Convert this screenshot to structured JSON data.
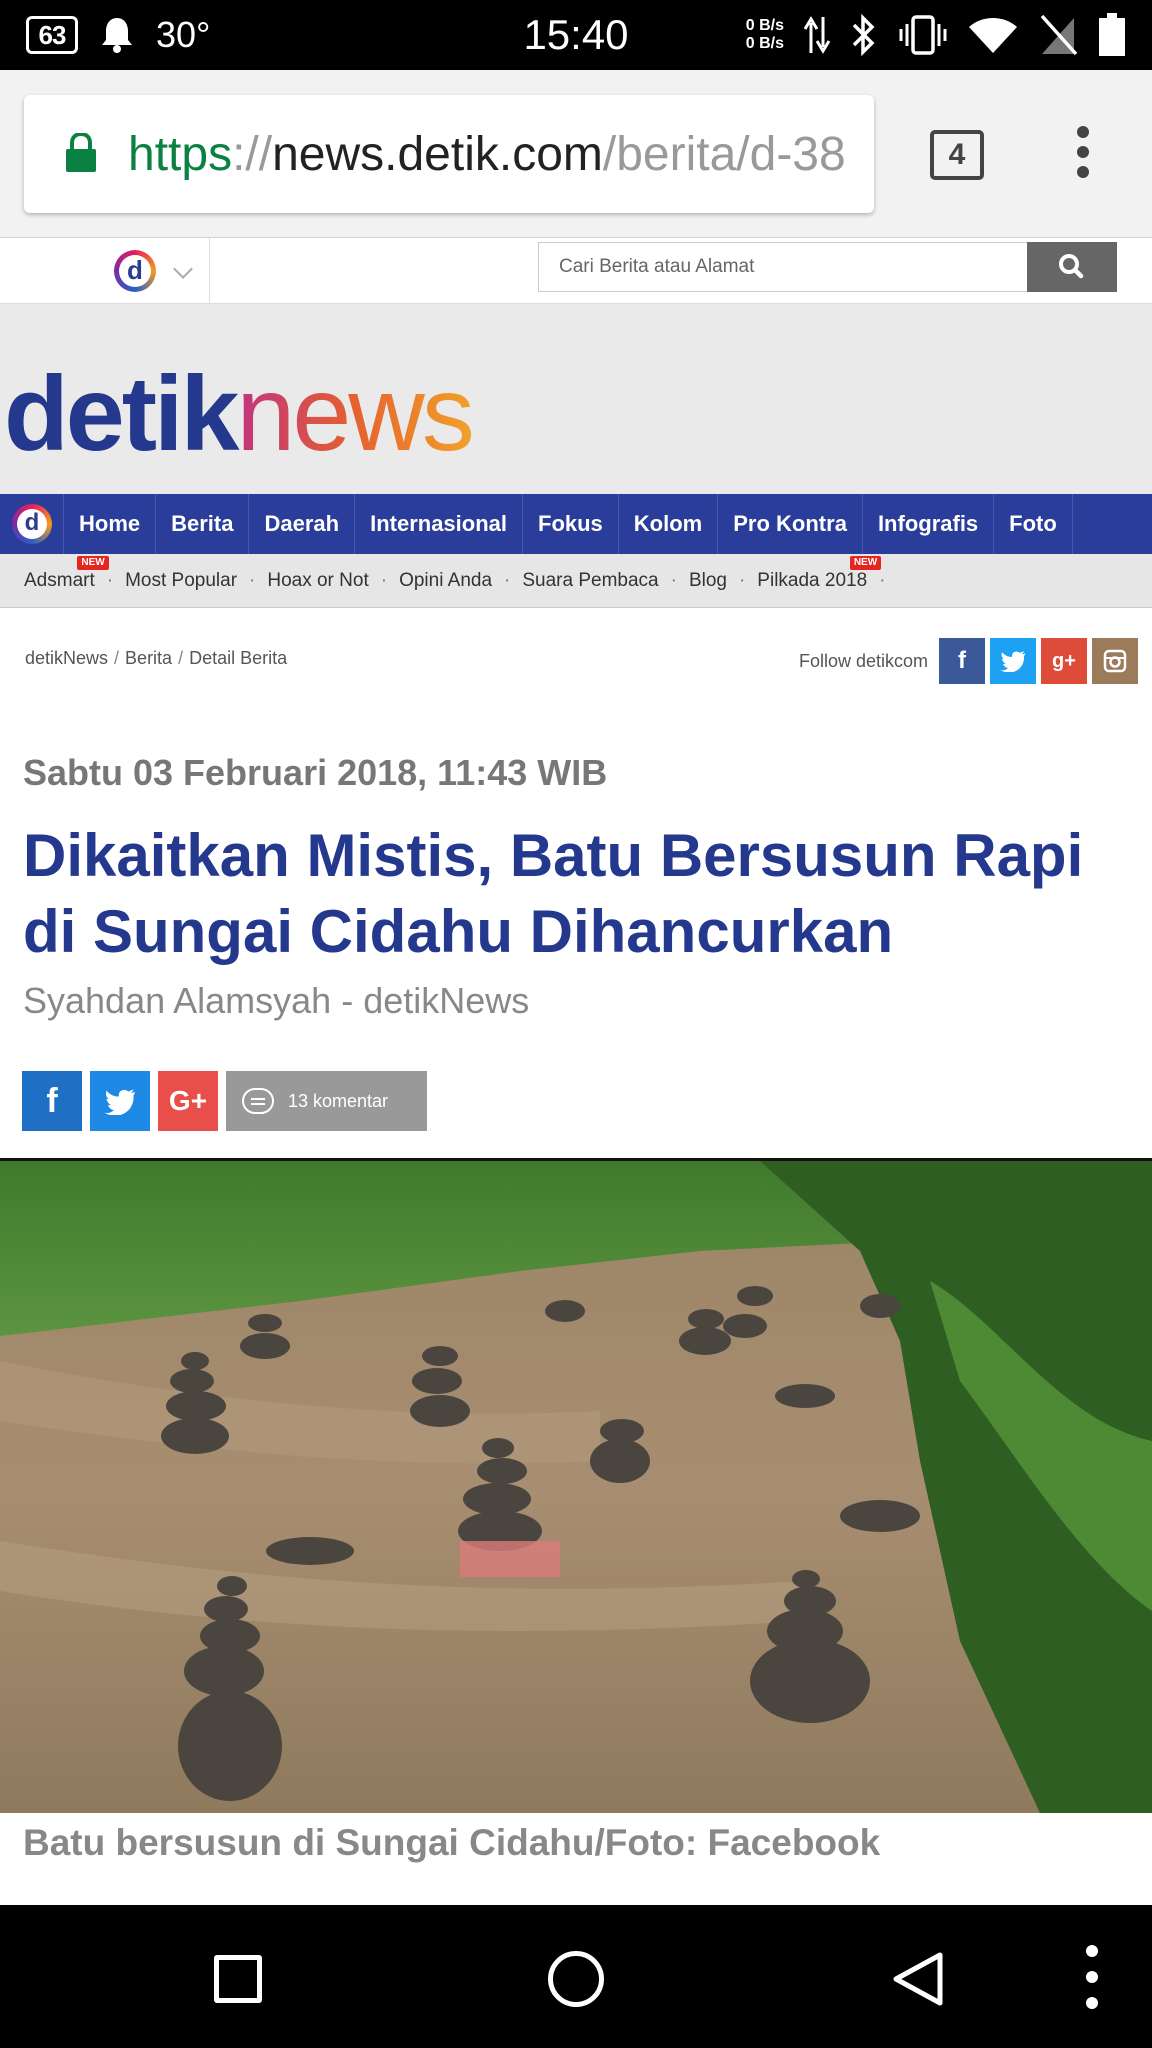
{
  "status_bar": {
    "battery_badge": "63",
    "temperature": "30°",
    "time": "15:40",
    "net_up": "0 B/s",
    "net_down": "0 B/s",
    "icons": [
      "battery-saver-icon",
      "notification-bell-icon",
      "data-arrows-icon",
      "bluetooth-icon",
      "vibrate-icon",
      "wifi-icon",
      "no-sim-icon",
      "battery-icon"
    ]
  },
  "browser": {
    "url_scheme": "https",
    "url_sep": "://",
    "url_host": "news.detik.com",
    "url_path": "/berita/d-38",
    "tab_count": "4",
    "icons": [
      "lock-icon",
      "overflow-menu-icon"
    ],
    "colors": {
      "secure": "#0b8043"
    }
  },
  "site_bar": {
    "logo_letter": "d",
    "search_placeholder": "Cari Berita atau Alamat",
    "icons": [
      "detik-logo-icon",
      "chevron-down-icon",
      "search-icon"
    ]
  },
  "masthead": {
    "brand_part1": "detik",
    "brand_part2": "news",
    "colors": {
      "brand_blue": "#24388d"
    }
  },
  "main_nav": {
    "logo_letter": "d",
    "items": [
      {
        "label": "Home"
      },
      {
        "label": "Berita"
      },
      {
        "label": "Daerah"
      },
      {
        "label": "Internasional"
      },
      {
        "label": "Fokus"
      },
      {
        "label": "Kolom"
      },
      {
        "label": "Pro Kontra"
      },
      {
        "label": "Infografis"
      },
      {
        "label": "Foto"
      }
    ],
    "colors": {
      "background": "#2a3d9a"
    }
  },
  "sub_nav": {
    "items": [
      {
        "label": "Adsmart",
        "badge": "NEW"
      },
      {
        "label": "Most Popular"
      },
      {
        "label": "Hoax or Not"
      },
      {
        "label": "Opini Anda"
      },
      {
        "label": "Suara Pembaca"
      },
      {
        "label": "Blog"
      },
      {
        "label": "Pilkada 2018",
        "badge": "NEW"
      }
    ],
    "separator": "·"
  },
  "breadcrumb": {
    "items": [
      "detikNews",
      "Berita",
      "Detail Berita"
    ],
    "separator": "/"
  },
  "follow": {
    "label": "Follow detikcom",
    "icons": [
      "facebook-icon",
      "twitter-icon",
      "google-plus-icon",
      "instagram-icon"
    ],
    "glyphs": {
      "facebook": "f",
      "google_plus": "g+"
    }
  },
  "article": {
    "date": "Sabtu 03 Februari 2018, 11:43 WIB",
    "headline": "Dikaitkan Mistis, Batu Bersusun Rapi di Sungai Cidahu Dihancurkan",
    "author": "Syahdan Alamsyah - detikNews",
    "share": {
      "glyphs": {
        "facebook": "f",
        "google_plus": "G+"
      },
      "comments_label": "13 komentar",
      "icons": [
        "facebook-icon",
        "twitter-icon",
        "google-plus-icon",
        "comment-icon"
      ]
    },
    "photo_caption": "Batu bersusun di Sungai Cidahu/Foto: Facebook",
    "photo_alt_icon": "river-stacked-stones-photo"
  },
  "nav_bar": {
    "icons": [
      "recents-square-icon",
      "home-circle-icon",
      "back-triangle-icon",
      "more-dots-icon"
    ]
  }
}
